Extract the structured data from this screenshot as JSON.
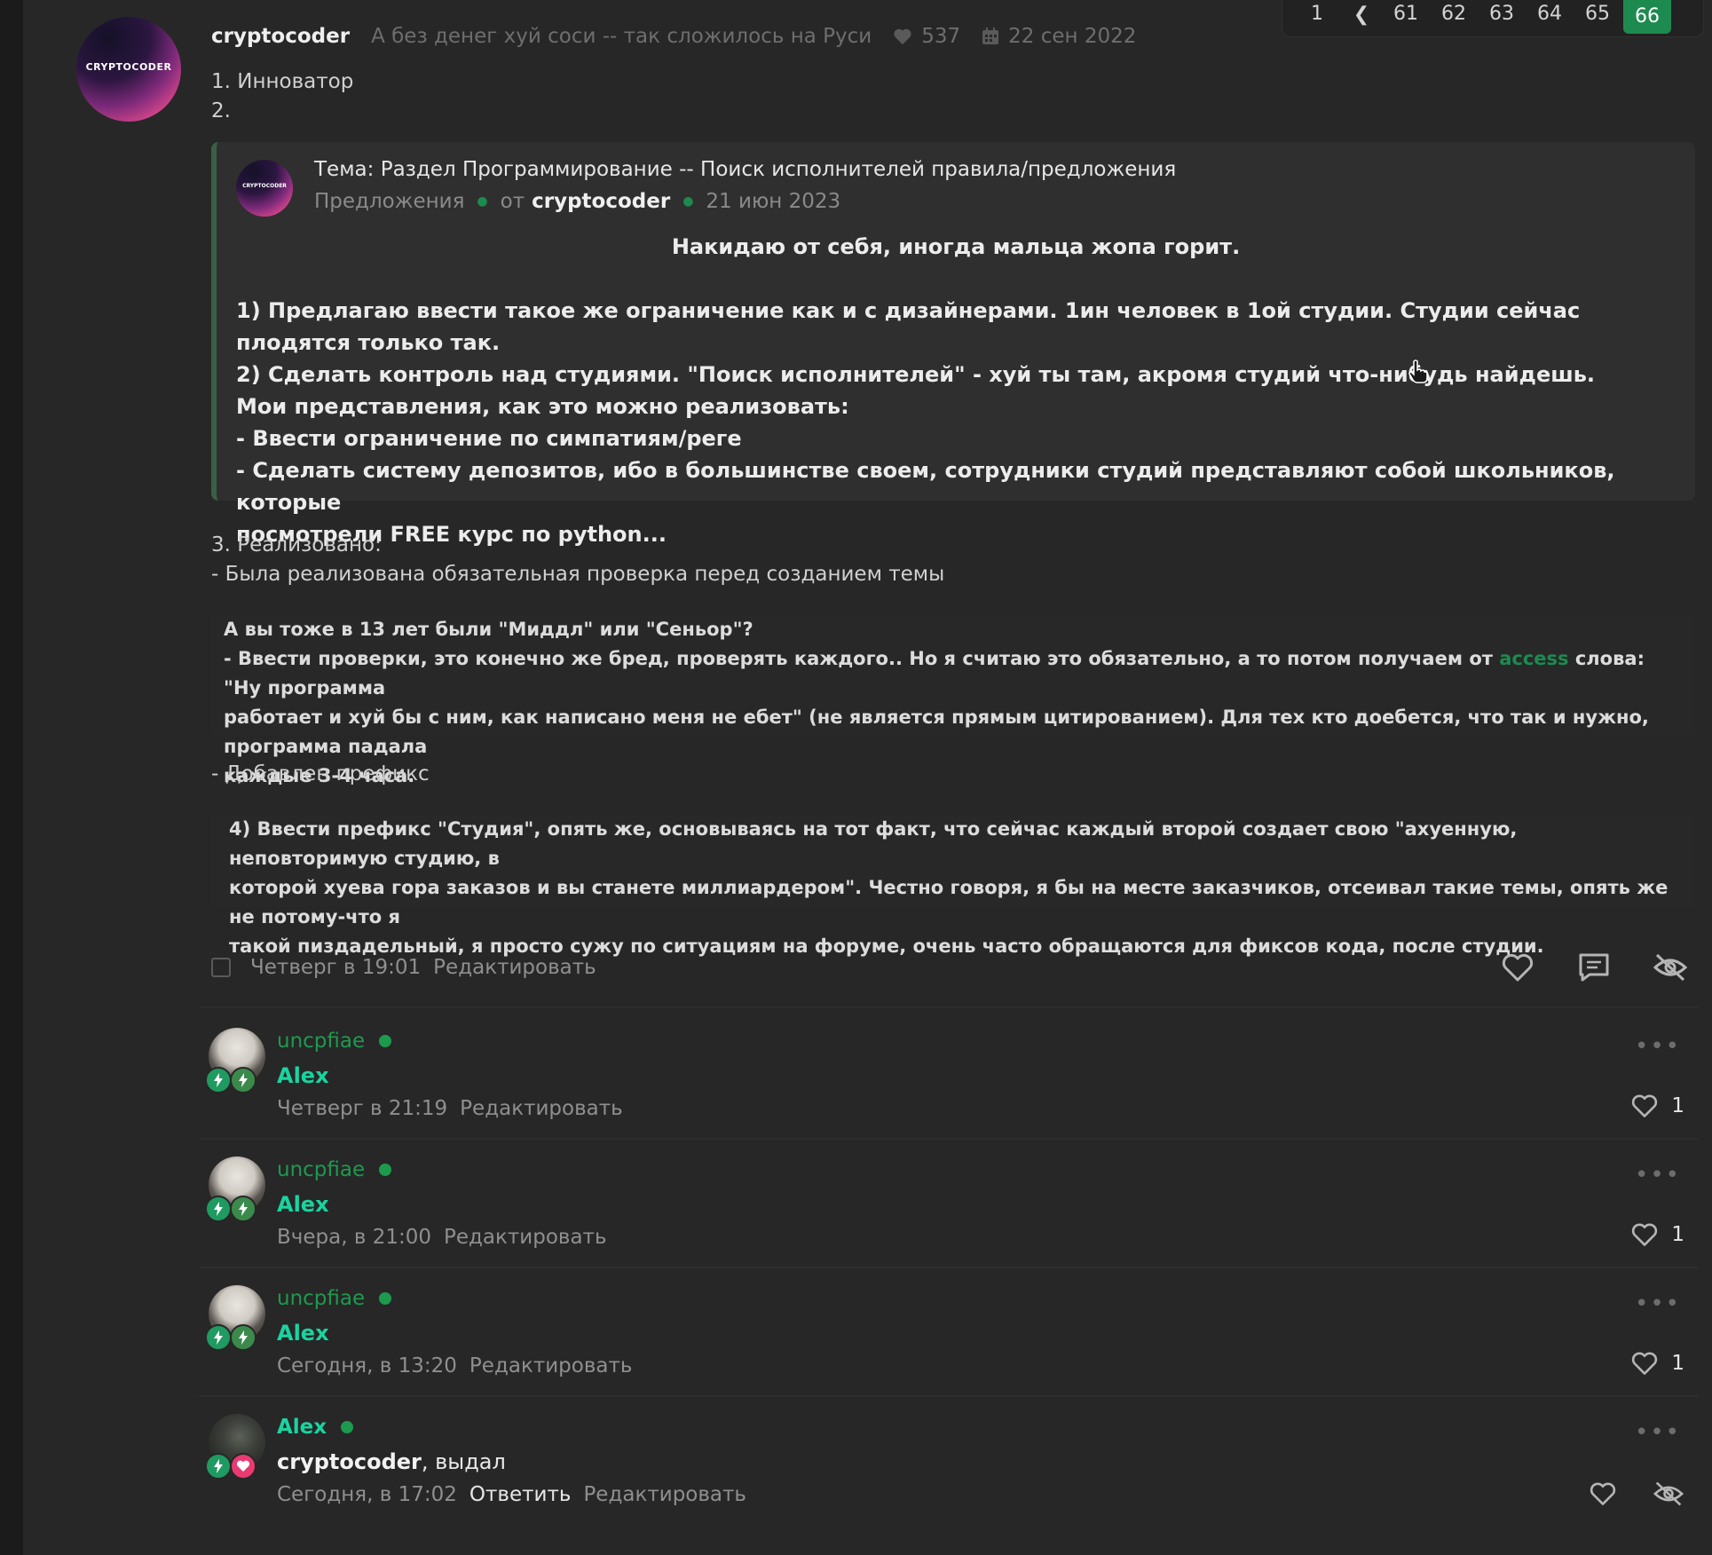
{
  "pagination": {
    "first": "1",
    "prev": "❮",
    "pages": [
      "61",
      "62",
      "63",
      "64",
      "65"
    ],
    "current": "66"
  },
  "post": {
    "author": "cryptocoder",
    "avatar_text": "CRYPTOCODER",
    "status": "А без денег хуй соси -- так сложилось на Руси",
    "likes": "537",
    "joined": "22 сен 2022",
    "list_1": "1. Инноватор",
    "list_2": "2.",
    "quote": {
      "avatar_text": "CRYPTOCODER",
      "title": "Тема: Раздел Программирование -- Поиск исполнителей правила/предложения",
      "section": "Предложения",
      "by": "от",
      "author": "cryptocoder",
      "date": "21 июн 2023",
      "center": "Накидаю от себя, иногда мальца жопа горит.",
      "lines": [
        "1) Предлагаю ввести такое же ограничение как и с дизайнерами. 1ин человек в 1ой студии. Студии сейчас плодятся только так.",
        "2) Сделать контроль над студиями. \"Поиск исполнителей\" - хуй ты там, акромя студий что-нибудь найдешь.",
        "Мои представления, как это можно реализовать:",
        "- Ввести ограничение по симпатиям/реге",
        "- Сделать систему депозитов, ибо в большинстве своем, сотрудники студий представляют собой школьников, которые",
        "посмотрели FREE курс по python..."
      ]
    },
    "implemented_title": "3. Реализовано:",
    "implemented_1": "- Была реализована обязательная проверка перед созданием темы",
    "embed1": {
      "line1": "А вы тоже в 13 лет были \"Миддл\" или \"Сеньор\"?",
      "line2_pre": "- Ввести проверки, это конечно же бред, проверять каждого.. Но я считаю это обязательно, а то потом получаем от ",
      "line2_link": "access",
      "line2_post": " слова: \"Ну программа",
      "line3": "работает и хуй бы с ним, как написано меня не ебет\" (не является прямым цитированием). Для тех кто доебется, что так и нужно, программа падала",
      "line4": "каждые 3-4 часа."
    },
    "prefix_added": "- Добавлен префикс",
    "embed2": {
      "line1": "4) Ввести префикс \"Студия\", опять же, основываясь на тот факт, что сейчас каждый второй создает свою \"ахуенную, неповторимую студию, в",
      "line2": "которой хуева гора заказов и вы станете миллиардером\". Честно говоря, я бы на месте заказчиков, отсеивал такие темы, опять же не потому-что я",
      "line3": "такой пиздадельный, я просто сужу по ситуациям на форуме, очень часто обращаются для фиксов кода, после студии."
    },
    "timestamp": "Четверг в 19:01",
    "edit": "Редактировать"
  },
  "comments": [
    {
      "name": "uncpfiae",
      "text": "Alex",
      "time": "Четверг в 21:19",
      "edit": "Редактировать",
      "likes": "1",
      "dots": "•••"
    },
    {
      "name": "uncpfiae",
      "text": "Alex",
      "time": "Вчера, в 21:00",
      "edit": "Редактировать",
      "likes": "1",
      "dots": "•••"
    },
    {
      "name": "uncpfiae",
      "text": "Alex",
      "time": "Сегодня, в 13:20",
      "edit": "Редактировать",
      "likes": "1",
      "dots": "•••"
    },
    {
      "name": "Alex",
      "text_strong": "cryptocoder",
      "text_rest": ", выдал",
      "time": "Сегодня, в 17:02",
      "reply": "Ответить",
      "edit": "Редактировать",
      "dots": "•••"
    }
  ],
  "colors": {
    "accent": "#1d8a4f",
    "background": "#272727",
    "username_green": "#1d9a4e",
    "alias_teal": "#1ad4a0"
  }
}
